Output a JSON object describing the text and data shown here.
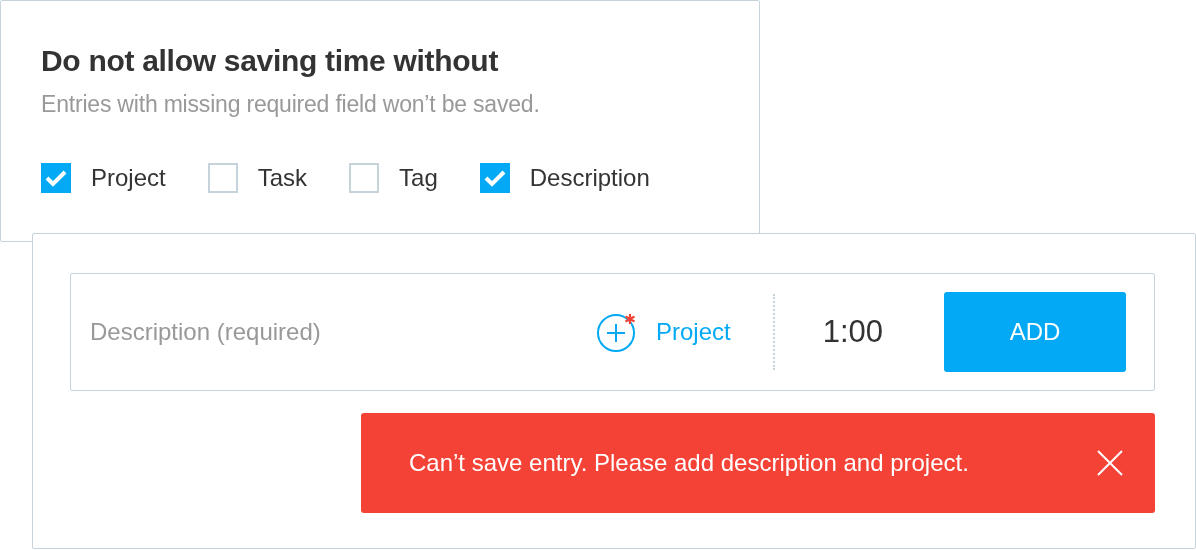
{
  "settings": {
    "title": "Do not allow saving time without",
    "subtitle": "Entries with missing required field won’t be saved.",
    "options": [
      {
        "label": "Project",
        "checked": true
      },
      {
        "label": "Task",
        "checked": false
      },
      {
        "label": "Tag",
        "checked": false
      },
      {
        "label": "Description",
        "checked": true
      }
    ]
  },
  "entry": {
    "placeholder": "Description (required)",
    "project_label": "Project",
    "project_required": true,
    "duration": "1:00",
    "add_button": "ADD"
  },
  "error": {
    "message": "Can’t save entry. Please add description and project."
  }
}
